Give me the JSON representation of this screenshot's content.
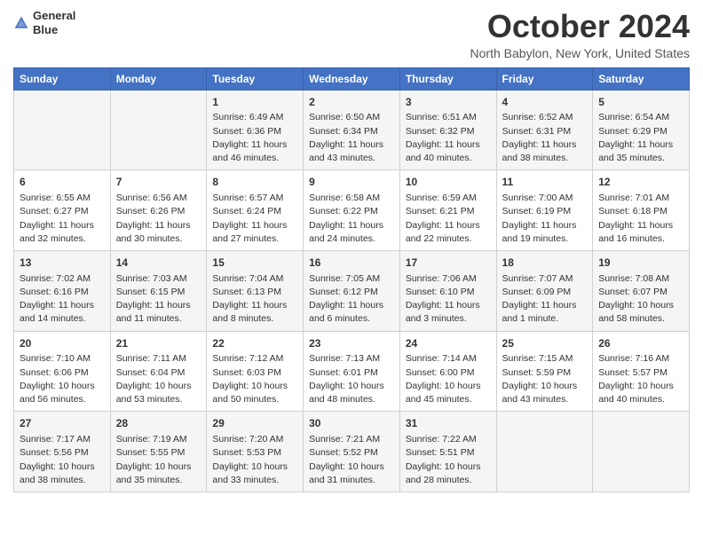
{
  "header": {
    "logo_line1": "General",
    "logo_line2": "Blue",
    "month": "October 2024",
    "location": "North Babylon, New York, United States"
  },
  "weekdays": [
    "Sunday",
    "Monday",
    "Tuesday",
    "Wednesday",
    "Thursday",
    "Friday",
    "Saturday"
  ],
  "weeks": [
    [
      {
        "day": null
      },
      {
        "day": null
      },
      {
        "day": "1",
        "sunrise": "Sunrise: 6:49 AM",
        "sunset": "Sunset: 6:36 PM",
        "daylight": "Daylight: 11 hours and 46 minutes."
      },
      {
        "day": "2",
        "sunrise": "Sunrise: 6:50 AM",
        "sunset": "Sunset: 6:34 PM",
        "daylight": "Daylight: 11 hours and 43 minutes."
      },
      {
        "day": "3",
        "sunrise": "Sunrise: 6:51 AM",
        "sunset": "Sunset: 6:32 PM",
        "daylight": "Daylight: 11 hours and 40 minutes."
      },
      {
        "day": "4",
        "sunrise": "Sunrise: 6:52 AM",
        "sunset": "Sunset: 6:31 PM",
        "daylight": "Daylight: 11 hours and 38 minutes."
      },
      {
        "day": "5",
        "sunrise": "Sunrise: 6:54 AM",
        "sunset": "Sunset: 6:29 PM",
        "daylight": "Daylight: 11 hours and 35 minutes."
      }
    ],
    [
      {
        "day": "6",
        "sunrise": "Sunrise: 6:55 AM",
        "sunset": "Sunset: 6:27 PM",
        "daylight": "Daylight: 11 hours and 32 minutes."
      },
      {
        "day": "7",
        "sunrise": "Sunrise: 6:56 AM",
        "sunset": "Sunset: 6:26 PM",
        "daylight": "Daylight: 11 hours and 30 minutes."
      },
      {
        "day": "8",
        "sunrise": "Sunrise: 6:57 AM",
        "sunset": "Sunset: 6:24 PM",
        "daylight": "Daylight: 11 hours and 27 minutes."
      },
      {
        "day": "9",
        "sunrise": "Sunrise: 6:58 AM",
        "sunset": "Sunset: 6:22 PM",
        "daylight": "Daylight: 11 hours and 24 minutes."
      },
      {
        "day": "10",
        "sunrise": "Sunrise: 6:59 AM",
        "sunset": "Sunset: 6:21 PM",
        "daylight": "Daylight: 11 hours and 22 minutes."
      },
      {
        "day": "11",
        "sunrise": "Sunrise: 7:00 AM",
        "sunset": "Sunset: 6:19 PM",
        "daylight": "Daylight: 11 hours and 19 minutes."
      },
      {
        "day": "12",
        "sunrise": "Sunrise: 7:01 AM",
        "sunset": "Sunset: 6:18 PM",
        "daylight": "Daylight: 11 hours and 16 minutes."
      }
    ],
    [
      {
        "day": "13",
        "sunrise": "Sunrise: 7:02 AM",
        "sunset": "Sunset: 6:16 PM",
        "daylight": "Daylight: 11 hours and 14 minutes."
      },
      {
        "day": "14",
        "sunrise": "Sunrise: 7:03 AM",
        "sunset": "Sunset: 6:15 PM",
        "daylight": "Daylight: 11 hours and 11 minutes."
      },
      {
        "day": "15",
        "sunrise": "Sunrise: 7:04 AM",
        "sunset": "Sunset: 6:13 PM",
        "daylight": "Daylight: 11 hours and 8 minutes."
      },
      {
        "day": "16",
        "sunrise": "Sunrise: 7:05 AM",
        "sunset": "Sunset: 6:12 PM",
        "daylight": "Daylight: 11 hours and 6 minutes."
      },
      {
        "day": "17",
        "sunrise": "Sunrise: 7:06 AM",
        "sunset": "Sunset: 6:10 PM",
        "daylight": "Daylight: 11 hours and 3 minutes."
      },
      {
        "day": "18",
        "sunrise": "Sunrise: 7:07 AM",
        "sunset": "Sunset: 6:09 PM",
        "daylight": "Daylight: 11 hours and 1 minute."
      },
      {
        "day": "19",
        "sunrise": "Sunrise: 7:08 AM",
        "sunset": "Sunset: 6:07 PM",
        "daylight": "Daylight: 10 hours and 58 minutes."
      }
    ],
    [
      {
        "day": "20",
        "sunrise": "Sunrise: 7:10 AM",
        "sunset": "Sunset: 6:06 PM",
        "daylight": "Daylight: 10 hours and 56 minutes."
      },
      {
        "day": "21",
        "sunrise": "Sunrise: 7:11 AM",
        "sunset": "Sunset: 6:04 PM",
        "daylight": "Daylight: 10 hours and 53 minutes."
      },
      {
        "day": "22",
        "sunrise": "Sunrise: 7:12 AM",
        "sunset": "Sunset: 6:03 PM",
        "daylight": "Daylight: 10 hours and 50 minutes."
      },
      {
        "day": "23",
        "sunrise": "Sunrise: 7:13 AM",
        "sunset": "Sunset: 6:01 PM",
        "daylight": "Daylight: 10 hours and 48 minutes."
      },
      {
        "day": "24",
        "sunrise": "Sunrise: 7:14 AM",
        "sunset": "Sunset: 6:00 PM",
        "daylight": "Daylight: 10 hours and 45 minutes."
      },
      {
        "day": "25",
        "sunrise": "Sunrise: 7:15 AM",
        "sunset": "Sunset: 5:59 PM",
        "daylight": "Daylight: 10 hours and 43 minutes."
      },
      {
        "day": "26",
        "sunrise": "Sunrise: 7:16 AM",
        "sunset": "Sunset: 5:57 PM",
        "daylight": "Daylight: 10 hours and 40 minutes."
      }
    ],
    [
      {
        "day": "27",
        "sunrise": "Sunrise: 7:17 AM",
        "sunset": "Sunset: 5:56 PM",
        "daylight": "Daylight: 10 hours and 38 minutes."
      },
      {
        "day": "28",
        "sunrise": "Sunrise: 7:19 AM",
        "sunset": "Sunset: 5:55 PM",
        "daylight": "Daylight: 10 hours and 35 minutes."
      },
      {
        "day": "29",
        "sunrise": "Sunrise: 7:20 AM",
        "sunset": "Sunset: 5:53 PM",
        "daylight": "Daylight: 10 hours and 33 minutes."
      },
      {
        "day": "30",
        "sunrise": "Sunrise: 7:21 AM",
        "sunset": "Sunset: 5:52 PM",
        "daylight": "Daylight: 10 hours and 31 minutes."
      },
      {
        "day": "31",
        "sunrise": "Sunrise: 7:22 AM",
        "sunset": "Sunset: 5:51 PM",
        "daylight": "Daylight: 10 hours and 28 minutes."
      },
      {
        "day": null
      },
      {
        "day": null
      }
    ]
  ]
}
